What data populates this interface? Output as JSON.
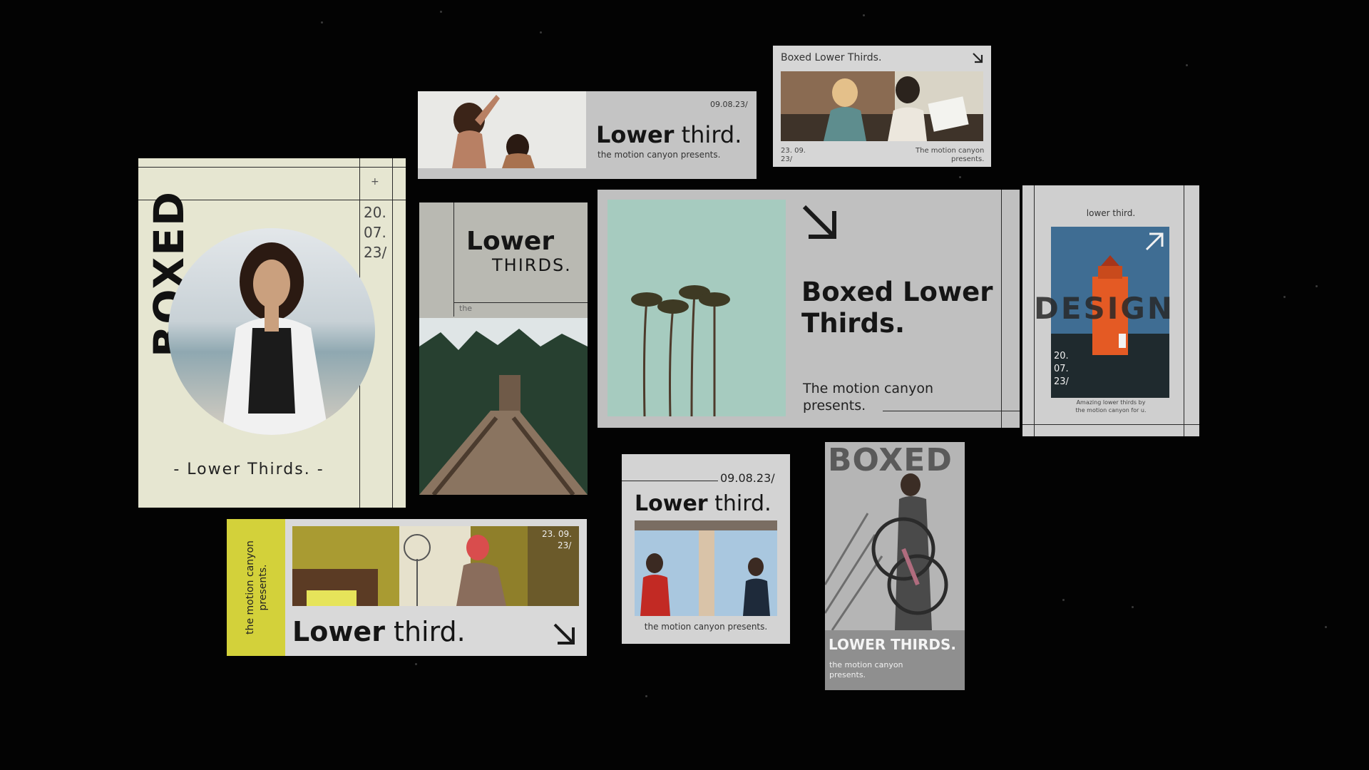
{
  "colors": {
    "background": "#030303",
    "cream": "#e6e6d1",
    "grey_card": "#c0c0c0",
    "yellow_accent": "#d3d13a"
  },
  "cards": {
    "boxed_portrait": {
      "vertical_title": "BOXED",
      "plus": "+",
      "date_lines": [
        "20.",
        "07.",
        "23/"
      ],
      "caption": "- Lower Thirds. -"
    },
    "wide_lower_third": {
      "date": "09.08.23/",
      "title_bold": "Lower",
      "title_light": "third.",
      "subtitle": "the motion canyon presents."
    },
    "small_boxed": {
      "header": "Boxed Lower Thirds.",
      "date": "23. 09.",
      "date_2": "23/",
      "credit_1": "The motion canyon",
      "credit_2": "presents.",
      "icon": "arrow-down-right-icon"
    },
    "lower_thirds_tall": {
      "title_1": "Lower",
      "title_2": "THIRDS.",
      "small": "the"
    },
    "main_boxed": {
      "title_1": "Boxed Lower",
      "title_2": "Thirds.",
      "sub_1": "The motion canyon",
      "sub_2": "presents.",
      "icon": "arrow-down-right-icon"
    },
    "design_card": {
      "label": "lower third.",
      "overlay": "DESIGN",
      "date_lines": [
        "20.",
        "07.",
        "23/"
      ],
      "caption_1": "Amazing lower thirds by",
      "caption_2": "the motion canyon for u.",
      "icon": "arrow-up-right-icon"
    },
    "yellow_strip": {
      "vertical_1": "the motion canyon",
      "vertical_2": "presents.",
      "date_1": "23. 09.",
      "date_2": "23/",
      "title_bold": "Lower",
      "title_light": "third.",
      "icon": "arrow-down-right-icon"
    },
    "band_card": {
      "date": "09.08.23/",
      "title_bold": "Lower",
      "title_light": "third.",
      "subtitle": "the motion canyon presents."
    },
    "bike_card": {
      "top_word": "BOXED",
      "title": "LOWER THIRDS.",
      "sub_1": "the motion canyon",
      "sub_2": "presents."
    }
  }
}
